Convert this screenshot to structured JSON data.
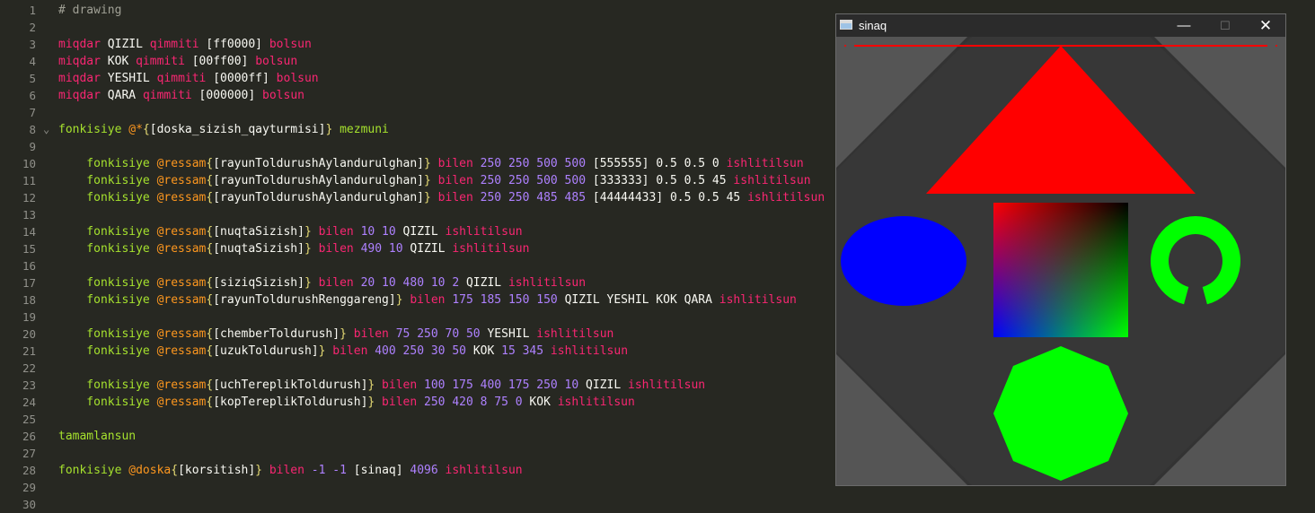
{
  "editor": {
    "lines": [
      {
        "n": "1",
        "tokens": [
          {
            "c": "comment",
            "t": "# drawing"
          }
        ]
      },
      {
        "n": "2",
        "tokens": []
      },
      {
        "n": "3",
        "tokens": [
          {
            "c": "kw",
            "t": "miqdar"
          },
          {
            "c": "id",
            "t": " QIZIL "
          },
          {
            "c": "kw",
            "t": "qimmiti"
          },
          {
            "c": "plain",
            "t": " [ff0000] "
          },
          {
            "c": "kw",
            "t": "bolsun"
          }
        ]
      },
      {
        "n": "4",
        "tokens": [
          {
            "c": "kw",
            "t": "miqdar"
          },
          {
            "c": "id",
            "t": " KOK "
          },
          {
            "c": "kw",
            "t": "qimmiti"
          },
          {
            "c": "plain",
            "t": " [00ff00] "
          },
          {
            "c": "kw",
            "t": "bolsun"
          }
        ]
      },
      {
        "n": "5",
        "tokens": [
          {
            "c": "kw",
            "t": "miqdar"
          },
          {
            "c": "id",
            "t": " YESHIL "
          },
          {
            "c": "kw",
            "t": "qimmiti"
          },
          {
            "c": "plain",
            "t": " [0000ff] "
          },
          {
            "c": "kw",
            "t": "bolsun"
          }
        ]
      },
      {
        "n": "6",
        "tokens": [
          {
            "c": "kw",
            "t": "miqdar"
          },
          {
            "c": "id",
            "t": " QARA "
          },
          {
            "c": "kw",
            "t": "qimmiti"
          },
          {
            "c": "plain",
            "t": " [000000] "
          },
          {
            "c": "kw",
            "t": "bolsun"
          }
        ]
      },
      {
        "n": "7",
        "tokens": []
      },
      {
        "n": "8",
        "fold": true,
        "tokens": [
          {
            "c": "fn",
            "t": "fonkisiye "
          },
          {
            "c": "at",
            "t": "@*"
          },
          {
            "c": "br",
            "t": "{"
          },
          {
            "c": "plain",
            "t": "[doska_sizish_qayturmisi]"
          },
          {
            "c": "br",
            "t": "}"
          },
          {
            "c": "fn",
            "t": " mezmuni"
          }
        ]
      },
      {
        "n": "9",
        "tokens": []
      },
      {
        "n": "10",
        "tokens": [
          {
            "c": "fn",
            "t": "    fonkisiye "
          },
          {
            "c": "at",
            "t": "@ressam"
          },
          {
            "c": "br",
            "t": "{"
          },
          {
            "c": "plain",
            "t": "[rayunToldurushAylandurulghan]"
          },
          {
            "c": "br",
            "t": "}"
          },
          {
            "c": "kw",
            "t": " bilen "
          },
          {
            "c": "num",
            "t": "250 250 500 500"
          },
          {
            "c": "plain",
            "t": " [555555] 0.5 0.5 0 "
          },
          {
            "c": "kw",
            "t": "ishlitilsun"
          }
        ]
      },
      {
        "n": "11",
        "tokens": [
          {
            "c": "fn",
            "t": "    fonkisiye "
          },
          {
            "c": "at",
            "t": "@ressam"
          },
          {
            "c": "br",
            "t": "{"
          },
          {
            "c": "plain",
            "t": "[rayunToldurushAylandurulghan]"
          },
          {
            "c": "br",
            "t": "}"
          },
          {
            "c": "kw",
            "t": " bilen "
          },
          {
            "c": "num",
            "t": "250 250 500 500"
          },
          {
            "c": "plain",
            "t": " [333333] 0.5 0.5 45 "
          },
          {
            "c": "kw",
            "t": "ishlitilsun"
          }
        ]
      },
      {
        "n": "12",
        "tokens": [
          {
            "c": "fn",
            "t": "    fonkisiye "
          },
          {
            "c": "at",
            "t": "@ressam"
          },
          {
            "c": "br",
            "t": "{"
          },
          {
            "c": "plain",
            "t": "[rayunToldurushAylandurulghan]"
          },
          {
            "c": "br",
            "t": "}"
          },
          {
            "c": "kw",
            "t": " bilen "
          },
          {
            "c": "num",
            "t": "250 250 485 485"
          },
          {
            "c": "plain",
            "t": " [44444433] 0.5 0.5 45 "
          },
          {
            "c": "kw",
            "t": "ishlitilsun"
          }
        ]
      },
      {
        "n": "13",
        "tokens": []
      },
      {
        "n": "14",
        "tokens": [
          {
            "c": "fn",
            "t": "    fonkisiye "
          },
          {
            "c": "at",
            "t": "@ressam"
          },
          {
            "c": "br",
            "t": "{"
          },
          {
            "c": "plain",
            "t": "[nuqtaSizish]"
          },
          {
            "c": "br",
            "t": "}"
          },
          {
            "c": "kw",
            "t": " bilen "
          },
          {
            "c": "num",
            "t": "10 10 "
          },
          {
            "c": "id",
            "t": "QIZIL "
          },
          {
            "c": "kw",
            "t": "ishlitilsun"
          }
        ]
      },
      {
        "n": "15",
        "tokens": [
          {
            "c": "fn",
            "t": "    fonkisiye "
          },
          {
            "c": "at",
            "t": "@ressam"
          },
          {
            "c": "br",
            "t": "{"
          },
          {
            "c": "plain",
            "t": "[nuqtaSizish]"
          },
          {
            "c": "br",
            "t": "}"
          },
          {
            "c": "kw",
            "t": " bilen "
          },
          {
            "c": "num",
            "t": "490 10 "
          },
          {
            "c": "id",
            "t": "QIZIL "
          },
          {
            "c": "kw",
            "t": "ishlitilsun"
          }
        ]
      },
      {
        "n": "16",
        "tokens": []
      },
      {
        "n": "17",
        "tokens": [
          {
            "c": "fn",
            "t": "    fonkisiye "
          },
          {
            "c": "at",
            "t": "@ressam"
          },
          {
            "c": "br",
            "t": "{"
          },
          {
            "c": "plain",
            "t": "[siziqSizish]"
          },
          {
            "c": "br",
            "t": "}"
          },
          {
            "c": "kw",
            "t": " bilen "
          },
          {
            "c": "num",
            "t": "20 10 480 10 2 "
          },
          {
            "c": "id",
            "t": "QIZIL "
          },
          {
            "c": "kw",
            "t": "ishlitilsun"
          }
        ]
      },
      {
        "n": "18",
        "tokens": [
          {
            "c": "fn",
            "t": "    fonkisiye "
          },
          {
            "c": "at",
            "t": "@ressam"
          },
          {
            "c": "br",
            "t": "{"
          },
          {
            "c": "plain",
            "t": "[rayunToldurushRenggareng]"
          },
          {
            "c": "br",
            "t": "}"
          },
          {
            "c": "kw",
            "t": " bilen "
          },
          {
            "c": "num",
            "t": "175 185 150 150 "
          },
          {
            "c": "id",
            "t": "QIZIL YESHIL KOK QARA "
          },
          {
            "c": "kw",
            "t": "ishlitilsun"
          }
        ]
      },
      {
        "n": "19",
        "tokens": []
      },
      {
        "n": "20",
        "tokens": [
          {
            "c": "fn",
            "t": "    fonkisiye "
          },
          {
            "c": "at",
            "t": "@ressam"
          },
          {
            "c": "br",
            "t": "{"
          },
          {
            "c": "plain",
            "t": "[chemberToldurush]"
          },
          {
            "c": "br",
            "t": "}"
          },
          {
            "c": "kw",
            "t": " bilen "
          },
          {
            "c": "num",
            "t": "75 250 70 50 "
          },
          {
            "c": "id",
            "t": "YESHIL "
          },
          {
            "c": "kw",
            "t": "ishlitilsun"
          }
        ]
      },
      {
        "n": "21",
        "tokens": [
          {
            "c": "fn",
            "t": "    fonkisiye "
          },
          {
            "c": "at",
            "t": "@ressam"
          },
          {
            "c": "br",
            "t": "{"
          },
          {
            "c": "plain",
            "t": "[uzukToldurush]"
          },
          {
            "c": "br",
            "t": "}"
          },
          {
            "c": "kw",
            "t": " bilen "
          },
          {
            "c": "num",
            "t": "400 250 30 50 "
          },
          {
            "c": "id",
            "t": "KOK "
          },
          {
            "c": "num",
            "t": "15 345 "
          },
          {
            "c": "kw",
            "t": "ishlitilsun"
          }
        ]
      },
      {
        "n": "22",
        "tokens": []
      },
      {
        "n": "23",
        "tokens": [
          {
            "c": "fn",
            "t": "    fonkisiye "
          },
          {
            "c": "at",
            "t": "@ressam"
          },
          {
            "c": "br",
            "t": "{"
          },
          {
            "c": "plain",
            "t": "[uchTereplikToldurush]"
          },
          {
            "c": "br",
            "t": "}"
          },
          {
            "c": "kw",
            "t": " bilen "
          },
          {
            "c": "num",
            "t": "100 175 400 175 250 10 "
          },
          {
            "c": "id",
            "t": "QIZIL "
          },
          {
            "c": "kw",
            "t": "ishlitilsun"
          }
        ]
      },
      {
        "n": "24",
        "tokens": [
          {
            "c": "fn",
            "t": "    fonkisiye "
          },
          {
            "c": "at",
            "t": "@ressam"
          },
          {
            "c": "br",
            "t": "{"
          },
          {
            "c": "plain",
            "t": "[kopTereplikToldurush]"
          },
          {
            "c": "br",
            "t": "}"
          },
          {
            "c": "kw",
            "t": " bilen "
          },
          {
            "c": "num",
            "t": "250 420 8 75 0 "
          },
          {
            "c": "id",
            "t": "KOK "
          },
          {
            "c": "kw",
            "t": "ishlitilsun"
          }
        ]
      },
      {
        "n": "25",
        "tokens": []
      },
      {
        "n": "26",
        "tokens": [
          {
            "c": "fn",
            "t": "tamamlansun"
          }
        ]
      },
      {
        "n": "27",
        "tokens": []
      },
      {
        "n": "28",
        "tokens": [
          {
            "c": "fn",
            "t": "fonkisiye "
          },
          {
            "c": "at",
            "t": "@doska"
          },
          {
            "c": "br",
            "t": "{"
          },
          {
            "c": "plain",
            "t": "[korsitish]"
          },
          {
            "c": "br",
            "t": "}"
          },
          {
            "c": "kw",
            "t": " bilen "
          },
          {
            "c": "num",
            "t": "-1 -1 "
          },
          {
            "c": "plain",
            "t": "[sinaq] "
          },
          {
            "c": "num",
            "t": "4096 "
          },
          {
            "c": "kw",
            "t": "ishlitilsun"
          }
        ]
      },
      {
        "n": "29",
        "tokens": []
      },
      {
        "n": "30",
        "tokens": []
      }
    ],
    "fold_icon": "chevron-down-icon"
  },
  "window": {
    "title": "sinaq",
    "icon": "app-window-icon",
    "minimize_symbol": "—",
    "maximize_symbol": "☐",
    "close_symbol": "✕"
  },
  "colors": {
    "red": "#ff0000",
    "green": "#00ff00",
    "blue": "#0000ff",
    "black": "#000000",
    "bg_light": "#555555",
    "bg_dark": "#333333",
    "bg_tint": "#44444433"
  }
}
